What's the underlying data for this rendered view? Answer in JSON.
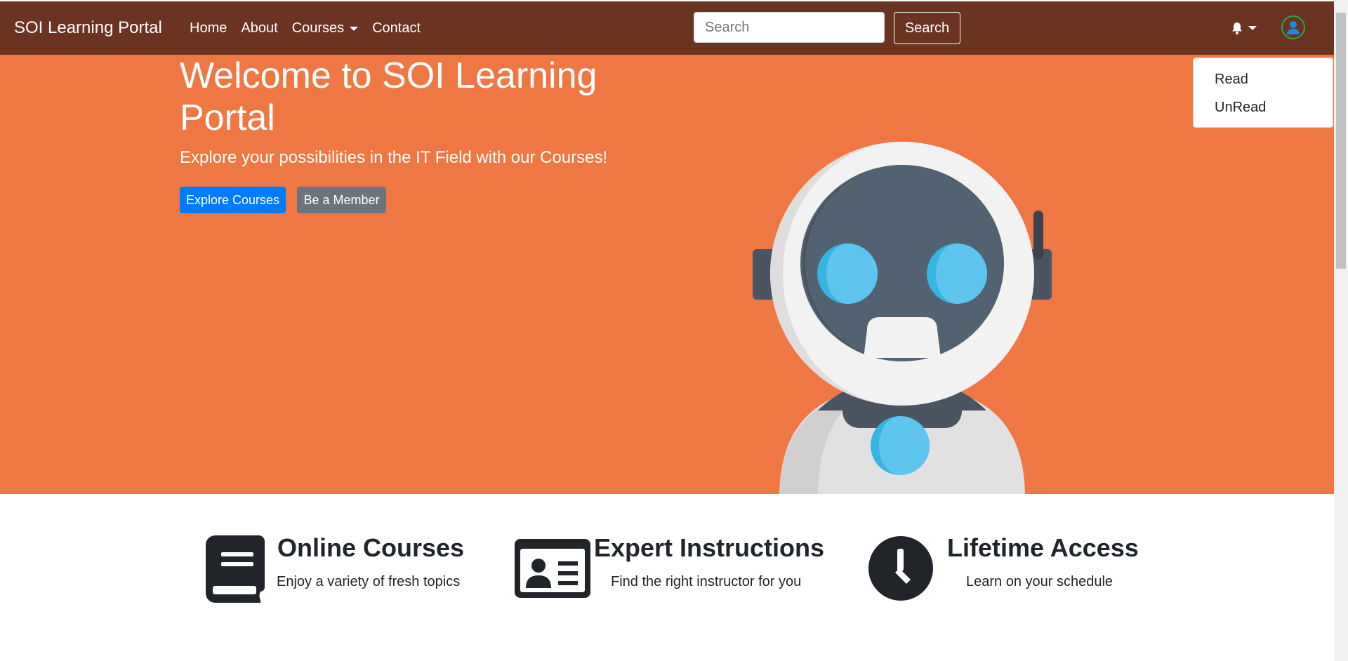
{
  "navbar": {
    "brand": "SOI Learning Portal",
    "links": [
      "Home",
      "About",
      "Courses",
      "Contact"
    ],
    "search_placeholder": "Search",
    "search_button": "Search",
    "bell_icon": "bell-icon",
    "avatar_icon": "user-icon",
    "colors": {
      "background": "#6a3420",
      "avatar_ring": "#28a745",
      "avatar_fill": "#1e88e5"
    }
  },
  "notifications_dropdown": {
    "items": [
      "Read",
      "UnRead"
    ]
  },
  "hero": {
    "title": "Welcome to SOI Learning Portal",
    "subtitle": "Explore your possibilities in the IT Field with our Courses!",
    "primary_button": "Explore Courses",
    "secondary_button": "Be a Member",
    "illustration": "robot-illustration",
    "colors": {
      "background": "#ef7744",
      "primary": "#007bff",
      "secondary": "#6c757d"
    }
  },
  "features": [
    {
      "icon": "book-icon",
      "title": "Online Courses",
      "text": "Enjoy a variety of fresh topics"
    },
    {
      "icon": "id-card-icon",
      "title": "Expert Instructions",
      "text": "Find the right instructor for you"
    },
    {
      "icon": "clock-icon",
      "title": "Lifetime Access",
      "text": "Learn on your schedule"
    }
  ]
}
